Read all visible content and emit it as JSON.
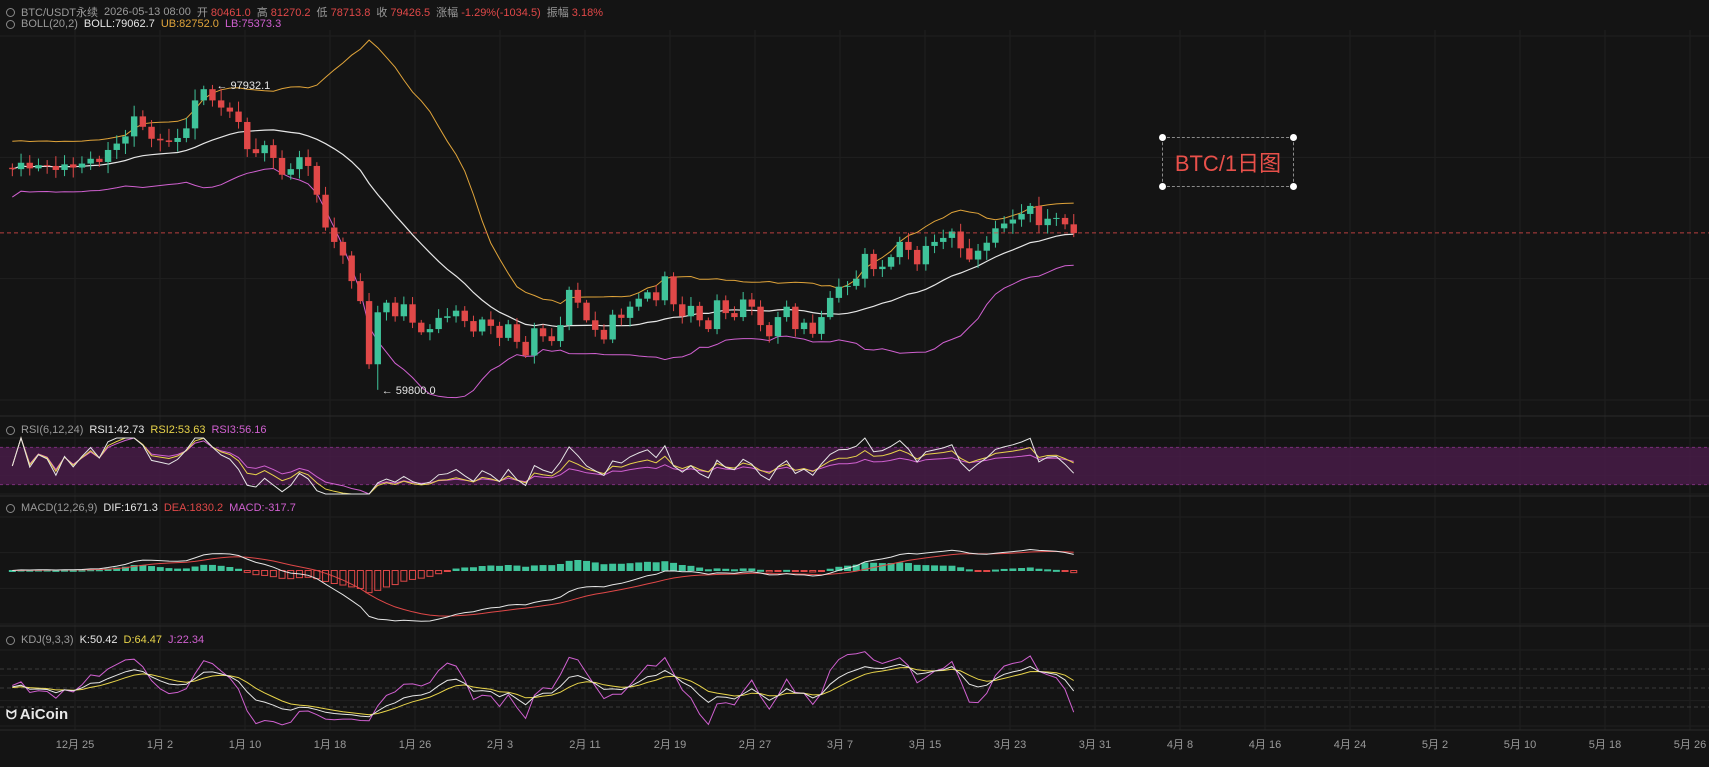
{
  "header": {
    "symbol": "BTC/USDT永续",
    "datetime": "2026-05-13 08:00",
    "open_label": "开",
    "open": "80461.0",
    "high_label": "高",
    "high": "81270.2",
    "low_label": "低",
    "low": "78713.8",
    "close_label": "收",
    "close": "79426.5",
    "change_label": "涨幅",
    "change": "-1.29%(-1034.5)",
    "amp_label": "振幅",
    "amp": "3.18%"
  },
  "indicators": {
    "boll": {
      "name": "BOLL(20,2)",
      "mid": "BOLL:79062.7",
      "ub": "UB:82752.0",
      "lb": "LB:75373.3"
    },
    "rsi": {
      "name": "RSI(6,12,24)",
      "rsi1": "RSI1:42.73",
      "rsi2": "RSI2:53.63",
      "rsi3": "RSI3:56.16"
    },
    "macd": {
      "name": "MACD(12,26,9)",
      "dif": "DIF:1671.3",
      "dea": "DEA:1830.2",
      "macd": "MACD:-317.7"
    },
    "kdj": {
      "name": "KDJ(9,3,3)",
      "k": "K:50.42",
      "d": "D:64.47",
      "j": "J:22.34"
    }
  },
  "annotation": "BTC/1日图",
  "logo": "AiCoin",
  "colors": {
    "up": "#3fc39a",
    "down": "#e04848",
    "ub": "#e0a43a",
    "mid": "#e6e6e6",
    "lb": "#d060d0",
    "rsi1": "#e6e6e6",
    "rsi2": "#e8d44a",
    "rsi3": "#d060d0",
    "dif": "#e6e6e6",
    "dea": "#e04848",
    "k": "#e6e6e6",
    "d": "#e8d44a",
    "j": "#d060d0",
    "rsi_band": "#4a1b4a",
    "current_price_line": "#e04848"
  },
  "chart_data": {
    "type": "candlestick",
    "x_ticks": [
      "12月 25",
      "1月 2",
      "1月 10",
      "1月 18",
      "1月 26",
      "2月 3",
      "2月 11",
      "2月 19",
      "2月 27",
      "3月 7",
      "3月 15",
      "3月 23",
      "3月 31",
      "4月 8",
      "4月 16",
      "4月 24",
      "5月 2",
      "5月 10",
      "5月 18",
      "5月 26"
    ],
    "max_label": "97932.1",
    "min_label": "59800.0",
    "last_close": 79426.5,
    "close_seed": [
      87400,
      88200,
      87500,
      87900,
      87800,
      87300,
      88000,
      87600,
      88100,
      88700,
      88300,
      89800,
      90600,
      91500,
      94000,
      92700,
      91200,
      91000,
      90800,
      91300,
      92500,
      96000,
      97400,
      96000,
      95100,
      94600,
      93300,
      89900,
      89400,
      90400,
      88800,
      86700,
      87400,
      88900,
      87800,
      84200,
      80100,
      78300,
      76600,
      73400,
      70900,
      63000,
      69500,
      70700,
      69000,
      70500,
      68200,
      67000,
      67400,
      68800,
      69000,
      69700,
      68400,
      67100,
      68600,
      67800,
      66300,
      68000,
      65800,
      64100,
      67500,
      66500,
      65900,
      67900,
      72300,
      70700,
      68500,
      67300,
      66100,
      69200,
      68800,
      70200,
      71200,
      72000,
      71000,
      74000,
      70500,
      69000,
      70300,
      68500,
      67400,
      71000,
      69400,
      68900,
      71100,
      70200,
      67900,
      66500,
      68900,
      70200,
      67400,
      68200,
      66800,
      68900,
      71300,
      72700,
      72800,
      73700,
      76800,
      74900,
      75200,
      76400,
      78300,
      77300,
      75500,
      77800,
      78300,
      78800,
      79600,
      77500,
      76100,
      77200,
      78200,
      80000,
      80600,
      81100,
      81800,
      82800,
      80400,
      81200,
      81300,
      80500,
      79400
    ],
    "rsi_range": [
      20,
      80
    ],
    "rsi_band": [
      30,
      70
    ],
    "kdj_levels": [
      80,
      50,
      20
    ]
  }
}
